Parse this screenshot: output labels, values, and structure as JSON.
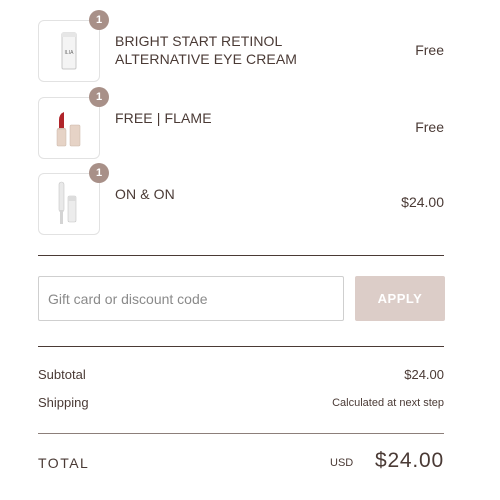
{
  "items": [
    {
      "name": "BRIGHT START RETINOL ALTERNATIVE EYE CREAM",
      "price": "Free",
      "quantity": "1",
      "thumb_label": "ILIA"
    },
    {
      "name": "FREE | FLAME",
      "price": "Free",
      "quantity": "1"
    },
    {
      "name": "ON & ON",
      "price": "$24.00",
      "quantity": "1"
    }
  ],
  "discount": {
    "placeholder": "Gift card or discount code",
    "apply_label": "APPLY"
  },
  "summary": {
    "subtotal_label": "Subtotal",
    "subtotal_value": "$24.00",
    "shipping_label": "Shipping",
    "shipping_value": "Calculated at next step"
  },
  "total": {
    "label": "TOTAL",
    "currency": "USD",
    "amount": "$24.00"
  },
  "colors": {
    "text": "#4a3a35",
    "badge": "#a89088",
    "apply_button": "#dccdc8",
    "border": "#e2e2e2"
  }
}
